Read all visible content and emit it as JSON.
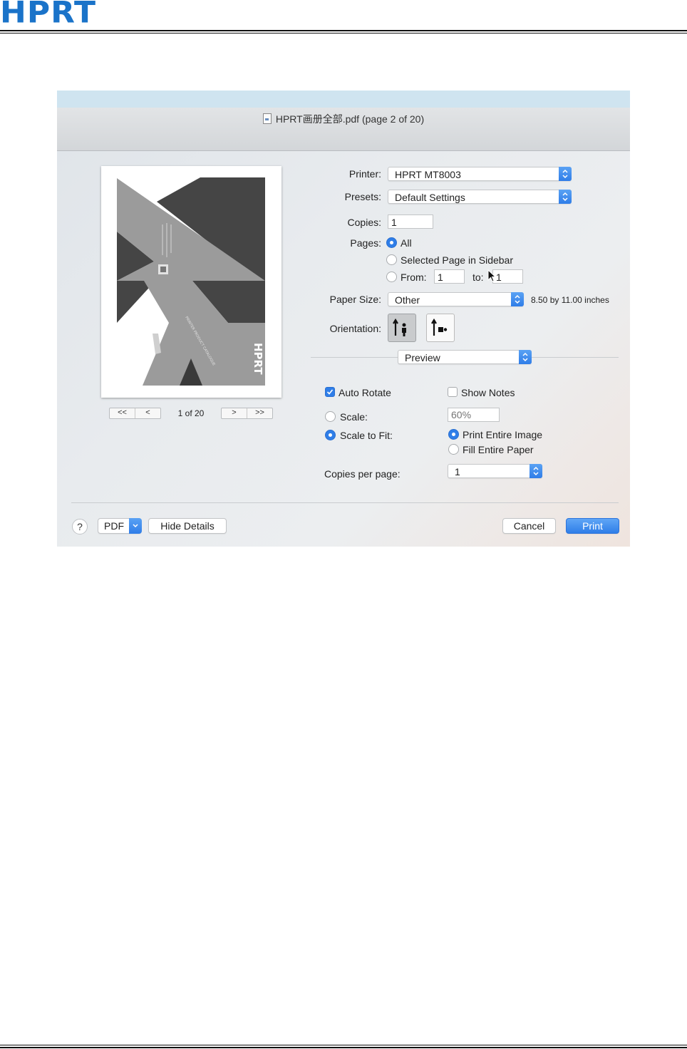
{
  "document": {
    "logo": "HPRT"
  },
  "dialog": {
    "title": "HPRT画册全部.pdf (page 2 of 20)",
    "preview": {
      "page_indicator": "1 of 20",
      "first_label": "<<",
      "prev_label": "<",
      "next_label": ">",
      "last_label": ">>"
    },
    "printer": {
      "label": "Printer:",
      "value": "HPRT MT8003"
    },
    "presets": {
      "label": "Presets:",
      "value": "Default Settings"
    },
    "copies": {
      "label": "Copies:",
      "value": "1"
    },
    "pages": {
      "label": "Pages:",
      "all_label": "All",
      "selected_label": "Selected Page in Sidebar",
      "from_label": "From:",
      "from_value": "1",
      "to_label": "to:",
      "to_value": "1",
      "selected": "all"
    },
    "paper_size": {
      "label": "Paper Size:",
      "value": "Other",
      "dimensions": "8.50 by 11.00 inches"
    },
    "orientation": {
      "label": "Orientation:",
      "selected": "portrait"
    },
    "section_select": {
      "value": "Preview"
    },
    "auto_rotate": {
      "label": "Auto Rotate",
      "checked": true
    },
    "show_notes": {
      "label": "Show Notes",
      "checked": false
    },
    "scale": {
      "label": "Scale:",
      "placeholder": "60%"
    },
    "scale_to_fit": {
      "label": "Scale to Fit:",
      "selected": true
    },
    "print_entire_image": {
      "label": "Print Entire Image",
      "selected": true
    },
    "fill_entire_paper": {
      "label": "Fill Entire Paper",
      "selected": false
    },
    "copies_per_page": {
      "label": "Copies per page:",
      "value": "1"
    },
    "footer": {
      "help_label": "?",
      "pdf_label": "PDF",
      "hide_details_label": "Hide Details",
      "cancel_label": "Cancel",
      "print_label": "Print"
    }
  },
  "colors": {
    "accent": "#2f7ee8",
    "logo": "#1a73c9",
    "titlebar_top": "#cfe4f0"
  }
}
